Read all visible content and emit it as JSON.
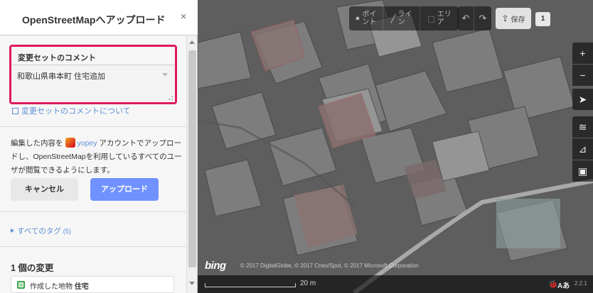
{
  "sidebar": {
    "title": "OpenStreetMapへアップロード",
    "close_icon": "×",
    "comment": {
      "label": "変更セットのコメント",
      "value": "和歌山県串本町 住宅追加"
    },
    "comment_link": "変更セットのコメントについて",
    "upload_desc_before": "編集した内容を",
    "username": "yopey",
    "upload_desc_after": "アカウントでアップロードし、OpenStreetMapを利用しているすべてのユーザが閲覧できるようにします。",
    "cancel_label": "キャンセル",
    "upload_label": "アップロード",
    "all_tags_label": "すべてのタグ",
    "all_tags_count": "(5)",
    "changes_title": "1 個の変更",
    "change_item": {
      "action": "作成した地物",
      "name": "住宅"
    }
  },
  "toolbar": {
    "point_label": "ポイ\nント",
    "line_label": "ライ\nン",
    "area_label": "エリ\nア",
    "save_label": "保存",
    "save_count": "1"
  },
  "map": {
    "bing_logo": "bing",
    "attribution": "© 2017 DigitalGlobe, © 2017 Cnes/Spot, © 2017 Microsoft Corporation",
    "scale_label": "20 m",
    "lang_label": "Aあ",
    "version": "2.2.1"
  }
}
